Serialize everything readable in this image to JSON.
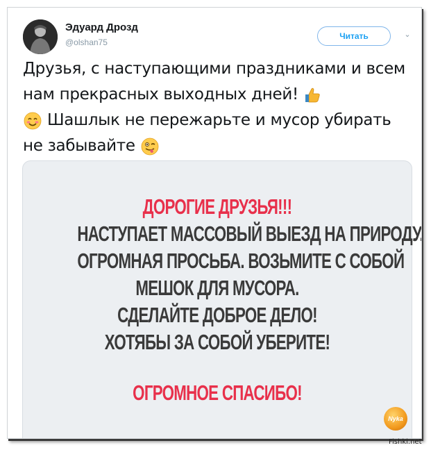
{
  "tweet": {
    "author_name": "Эдуард Дрозд",
    "author_handle": "@olshan75",
    "follow_label": "Читать",
    "text_part1": "Друзья, с наступающими праздниками и всем нам прекрасных выходных дней!",
    "text_part2": "Шашлык не пережарьте и мусор убирать не забывайте"
  },
  "poster": {
    "headline": "ДОРОГИЕ ДРУЗЬЯ!!!",
    "lines": [
      "НАСТУПАЕТ МАССОВЫЙ ВЫЕЗД НА ПРИРОДУ.",
      "ОГРОМНАЯ ПРОСЬБА. ВОЗЬМИТЕ С СОБОЙ",
      "МЕШОК ДЛЯ МУСОРА.",
      "СДЕЛАЙТЕ ДОБРОЕ ДЕЛО!",
      "ХОТЯБЫ ЗА СОБОЙ УБЕРИТЕ!"
    ],
    "closing": "ОГРОМНОЕ СПАСИБО!"
  },
  "badge_text": "Nyka",
  "watermark": "Fishki.net",
  "icons": [
    "chevron-down-icon",
    "thumbs-up-emoji",
    "smiling-face-emoji",
    "winking-tongue-emoji"
  ],
  "colors": {
    "follow_blue": "#1da1f2",
    "poster_red": "#e8304b",
    "poster_dark": "#3a3a3a",
    "card_bg": "#eceff2"
  }
}
